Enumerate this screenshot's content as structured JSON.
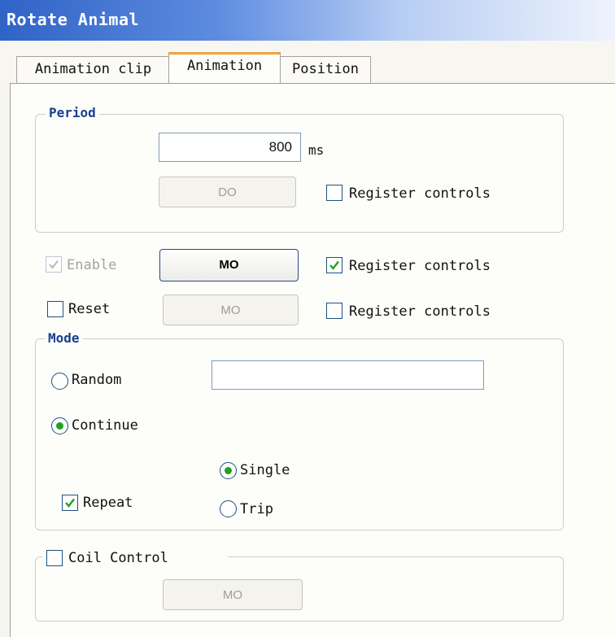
{
  "window": {
    "title": "Rotate Animal"
  },
  "tabs": [
    {
      "label": "Animation clip",
      "active": false
    },
    {
      "label": "Animation",
      "active": true
    },
    {
      "label": "Position",
      "active": false
    }
  ],
  "period": {
    "legend": "Period",
    "value": "800",
    "unit": "ms",
    "button_label": "DO",
    "register_label": "Register controls",
    "register_checked": false
  },
  "enable": {
    "label": "Enable",
    "checked": true,
    "disabled": true,
    "button_label": "MO",
    "register_label": "Register controls",
    "register_checked": true
  },
  "reset": {
    "label": "Reset",
    "checked": false,
    "button_label": "MO",
    "register_label": "Register controls",
    "register_checked": false
  },
  "mode": {
    "legend": "Mode",
    "random_label": "Random",
    "random_value": "",
    "continue_label": "Continue",
    "selected": "continue",
    "repeat_label": "Repeat",
    "repeat_checked": true,
    "single_label": "Single",
    "trip_label": "Trip",
    "repeat_mode": "single"
  },
  "coil": {
    "label": "Coil Control",
    "checked": false,
    "button_label": "MO"
  },
  "colors": {
    "title_gradient_start": "#2f63c6",
    "active_tab_accent": "#f0a33b",
    "legend_text": "#1b3f8e",
    "check_mark": "#21a121"
  }
}
